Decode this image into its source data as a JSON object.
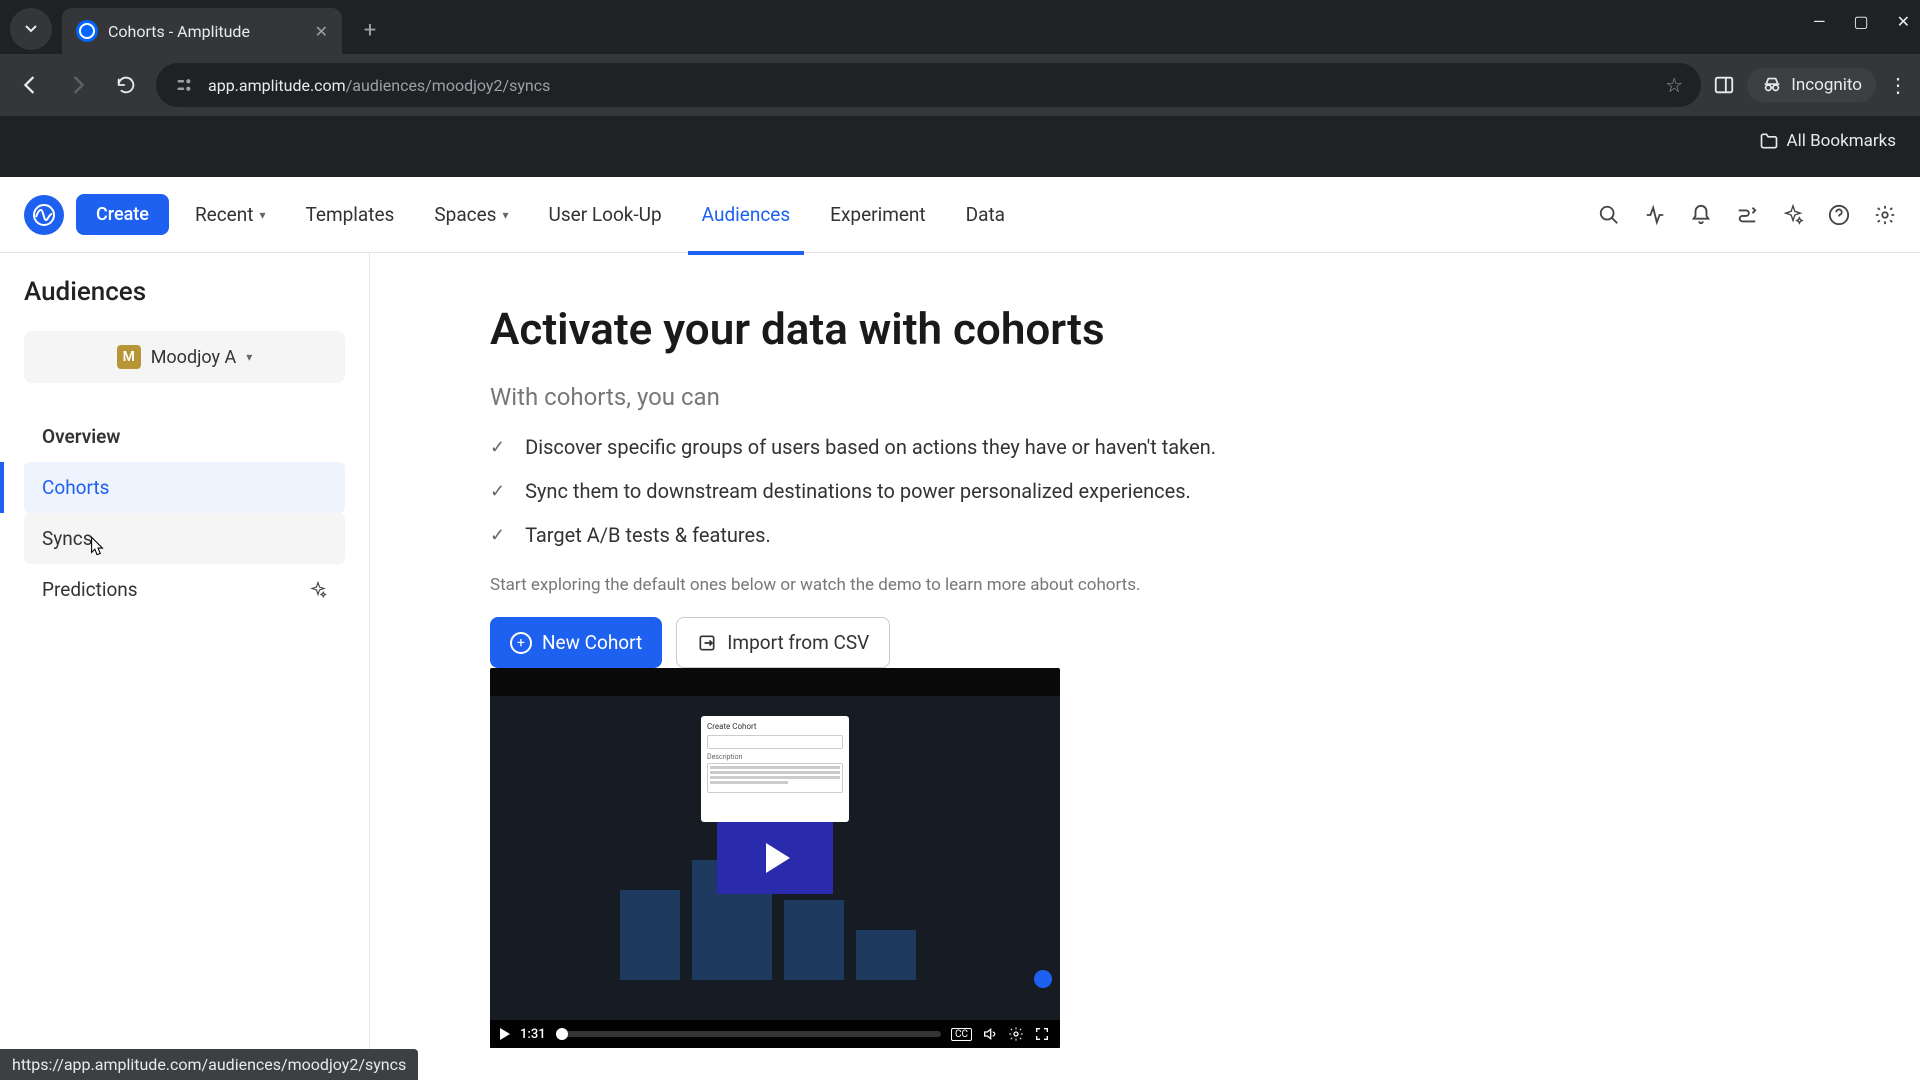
{
  "browser": {
    "tab_title": "Cohorts - Amplitude",
    "url_domain": "app.amplitude.com",
    "url_path": "/audiences/moodjoy2/syncs",
    "incognito_label": "Incognito",
    "all_bookmarks": "All Bookmarks",
    "status_url": "https://app.amplitude.com/audiences/moodjoy2/syncs"
  },
  "header": {
    "create": "Create",
    "nav": {
      "recent": "Recent",
      "templates": "Templates",
      "spaces": "Spaces",
      "user_lookup": "User Look-Up",
      "audiences": "Audiences",
      "experiment": "Experiment",
      "data": "Data"
    }
  },
  "sidebar": {
    "title": "Audiences",
    "workspace_initial": "M",
    "workspace_name": "Moodjoy A",
    "items": {
      "overview": "Overview",
      "cohorts": "Cohorts",
      "syncs": "Syncs",
      "predictions": "Predictions"
    }
  },
  "main": {
    "title": "Activate your data with cohorts",
    "subtitle": "With cohorts, you can",
    "bullets": [
      "Discover specific groups of users based on actions they have or haven't taken.",
      "Sync them to downstream destinations to power personalized experiences.",
      "Target A/B tests & features."
    ],
    "hint": "Start exploring the default ones below or watch the demo to learn more about cohorts.",
    "new_cohort": "New Cohort",
    "import_csv": "Import from CSV",
    "video": {
      "dialog_title": "Create Cohort",
      "dialog_desc": "Description",
      "time": "1:31",
      "cc": "CC"
    }
  }
}
